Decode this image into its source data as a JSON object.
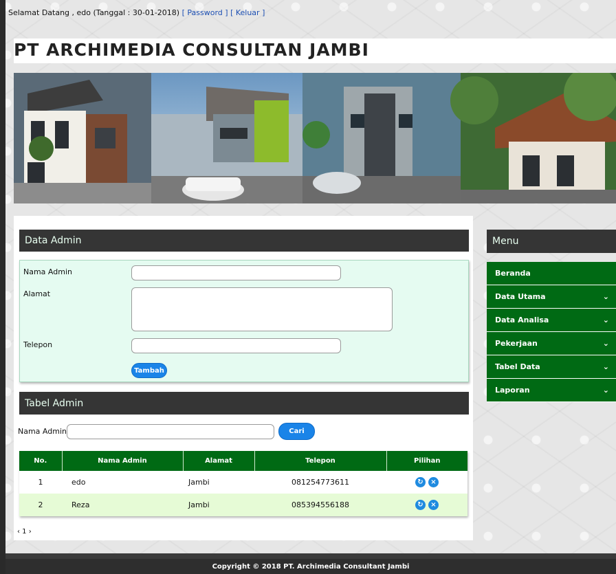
{
  "header": {
    "welcome_text": "Selamat Datang , edo (Tanggal : 30-01-2018)",
    "password_link": "[ Password ]",
    "logout_link": "[ Keluar ]",
    "site_title": "PT ARCHIMEDIA CONSULTAN JAMBI"
  },
  "form_section": {
    "title": "Data Admin",
    "name_label": "Nama Admin",
    "address_label": "Alamat",
    "phone_label": "Telepon",
    "submit_label": "Tambah"
  },
  "table_section": {
    "title": "Tabel Admin",
    "search_label": "Nama Admin :",
    "search_button": "Cari",
    "columns": [
      "No.",
      "Nama Admin",
      "Alamat",
      "Telepon",
      "Pilihan"
    ],
    "rows": [
      {
        "no": "1",
        "name": "edo",
        "address": "Jambi",
        "phone": "081254773611"
      },
      {
        "no": "2",
        "name": "Reza",
        "address": "Jambi",
        "phone": "085394556188"
      }
    ],
    "pagination": "‹ 1 ›"
  },
  "sidebar": {
    "title": "Menu",
    "items": [
      {
        "label": "Beranda",
        "has_dropdown": false
      },
      {
        "label": "Data Utama",
        "has_dropdown": true
      },
      {
        "label": "Data Analisa",
        "has_dropdown": true
      },
      {
        "label": "Pekerjaan",
        "has_dropdown": true
      },
      {
        "label": "Tabel Data",
        "has_dropdown": true
      },
      {
        "label": "Laporan",
        "has_dropdown": true
      }
    ]
  },
  "footer": {
    "copyright": "Copyright © 2018 PT. Archimedia Consultant Jambi"
  },
  "icons": {
    "edit": "refresh-icon",
    "delete": "close-icon",
    "dropdown": "chevron-down-icon"
  },
  "colors": {
    "menu_green": "#006a14",
    "section_dark": "#353535",
    "form_bg": "#e5fbf1",
    "button_blue": "#1a84e8"
  }
}
